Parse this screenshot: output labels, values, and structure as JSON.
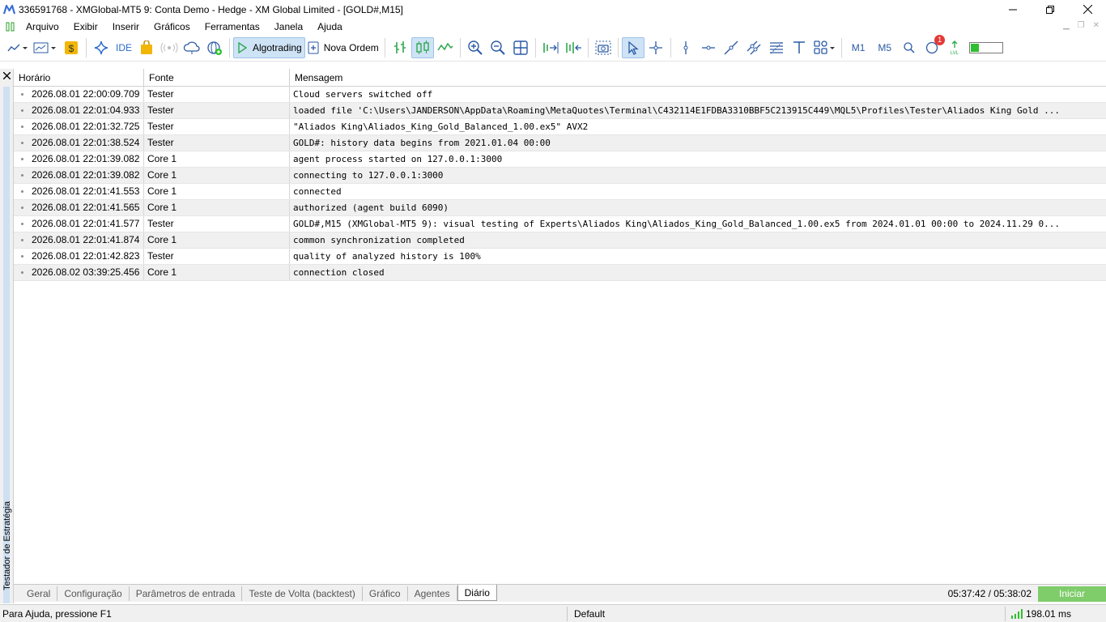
{
  "window": {
    "title": "336591768 - XMGlobal-MT5 9: Conta Demo - Hedge - XM Global Limited - [GOLD#,M15]",
    "controls": [
      "minimize",
      "restore",
      "close"
    ]
  },
  "menu": {
    "items": [
      "Arquivo",
      "Exibir",
      "Inserir",
      "Gráficos",
      "Ferramentas",
      "Janela",
      "Ajuda"
    ]
  },
  "toolbar": {
    "ide_label": "IDE",
    "algotrading_label": "Algotrading",
    "new_order_label": "Nova Ordem",
    "timeframes": [
      "M1",
      "M5"
    ],
    "notification_count": "1",
    "connection_level": 0.3,
    "icons": {
      "chart_type": "line-chart-icon",
      "profiles": "chart-profiles-icon",
      "market": "dollar-coin-icon",
      "strategy": "sparkle-icon",
      "signals": "signal-bag-icon",
      "radio": "radio-icon",
      "cloud": "cloud-icon",
      "vps": "globe-plus-icon"
    },
    "colors": {
      "active_bg": "#cfe3f6",
      "accent": "#2a6cc7",
      "green": "#2fbf2f"
    }
  },
  "side": {
    "label": "Testador de Estratégia"
  },
  "journal": {
    "columns": [
      "Horário",
      "Fonte",
      "Mensagem"
    ],
    "rows": [
      {
        "time": "2026.08.01 22:00:09.709",
        "source": "Tester",
        "message": "Cloud servers switched off"
      },
      {
        "time": "2026.08.01 22:01:04.933",
        "source": "Tester",
        "message": "loaded file 'C:\\Users\\JANDERSON\\AppData\\Roaming\\MetaQuotes\\Terminal\\C432114E1FDBA3310BBF5C213915C449\\MQL5\\Profiles\\Tester\\Aliados King Gold ..."
      },
      {
        "time": "2026.08.01 22:01:32.725",
        "source": "Tester",
        "message": "\"Aliados King\\Aliados_King_Gold_Balanced_1.00.ex5\" AVX2"
      },
      {
        "time": "2026.08.01 22:01:38.524",
        "source": "Tester",
        "message": "GOLD#: history data begins from 2021.01.04 00:00"
      },
      {
        "time": "2026.08.01 22:01:39.082",
        "source": "Core 1",
        "message": "agent process started on 127.0.0.1:3000"
      },
      {
        "time": "2026.08.01 22:01:39.082",
        "source": "Core 1",
        "message": "connecting to 127.0.0.1:3000"
      },
      {
        "time": "2026.08.01 22:01:41.553",
        "source": "Core 1",
        "message": "connected"
      },
      {
        "time": "2026.08.01 22:01:41.565",
        "source": "Core 1",
        "message": "authorized (agent build 6090)"
      },
      {
        "time": "2026.08.01 22:01:41.577",
        "source": "Tester",
        "message": "GOLD#,M15 (XMGlobal-MT5 9): visual testing of Experts\\Aliados King\\Aliados_King_Gold_Balanced_1.00.ex5 from 2024.01.01 00:00 to 2024.11.29 0..."
      },
      {
        "time": "2026.08.01 22:01:41.874",
        "source": "Core 1",
        "message": "common synchronization completed"
      },
      {
        "time": "2026.08.01 22:01:42.823",
        "source": "Tester",
        "message": "quality of analyzed history is 100%"
      },
      {
        "time": "2026.08.02 03:39:25.456",
        "source": "Core 1",
        "message": "connection closed"
      }
    ]
  },
  "tabs": {
    "items": [
      "Geral",
      "Configuração",
      "Parâmetros de entrada",
      "Teste de Volta (backtest)",
      "Gráfico",
      "Agentes",
      "Diário"
    ],
    "active": "Diário",
    "timer": "05:37:42 / 05:38:02",
    "start_label": "Iniciar"
  },
  "status": {
    "help": "Para Ajuda, pressione F1",
    "profile": "Default",
    "ping": "198.01 ms"
  }
}
